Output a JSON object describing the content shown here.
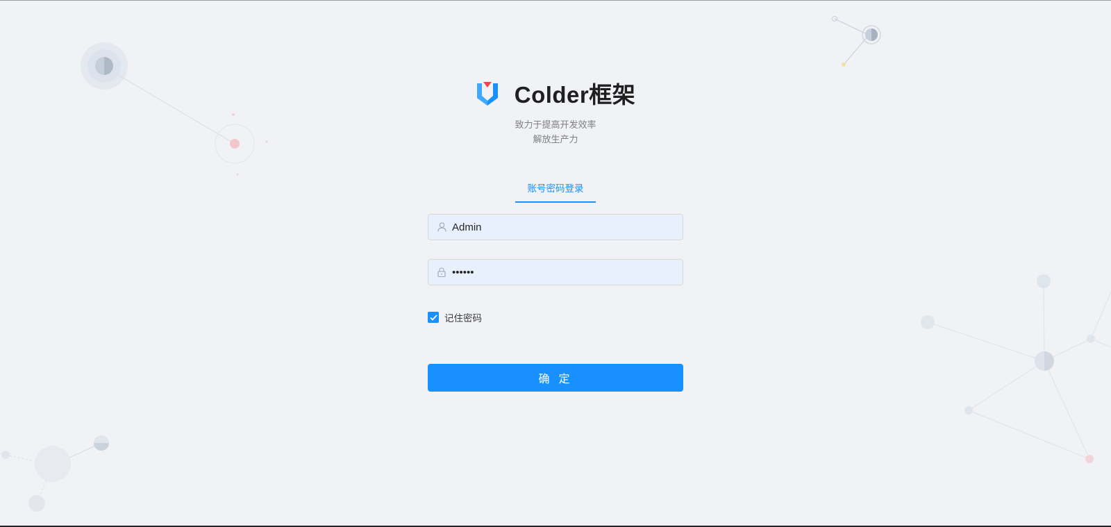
{
  "brand": {
    "logo_icon": "colder-logo-icon",
    "title": "Colder框架",
    "slogan_line1": "致力于提高开发效率",
    "slogan_line2": "解放生产力"
  },
  "tabs": [
    {
      "label": "账号密码登录",
      "active": true
    }
  ],
  "form": {
    "username_value": "Admin",
    "username_icon": "user-icon",
    "password_value": "••••••",
    "password_icon": "lock-icon",
    "remember_label": "记住密码",
    "remember_checked": true,
    "submit_label": "确 定"
  },
  "colors": {
    "accent": "#1890ff",
    "background": "#f0f2f5",
    "input_fill": "#e8f0fe"
  }
}
